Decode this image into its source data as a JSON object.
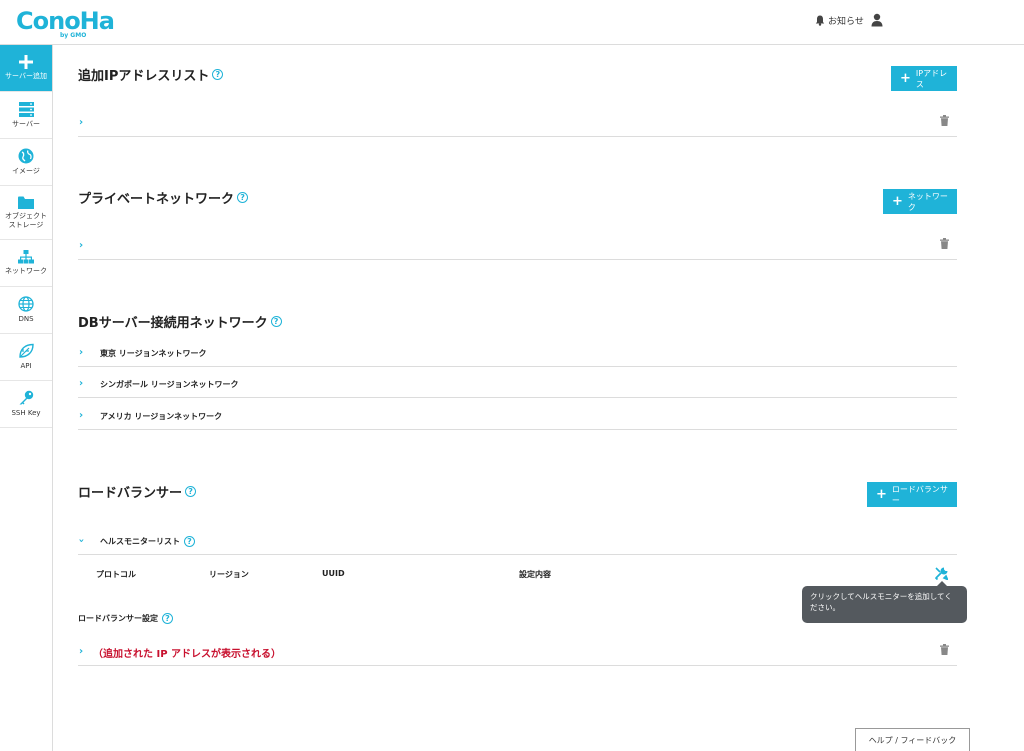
{
  "header": {
    "logo_text": "ConoHa",
    "logo_sub": "by GMO",
    "notice_label": "お知らせ"
  },
  "sidebar": {
    "items": [
      {
        "label": "サーバー追加",
        "icon": "plus-icon"
      },
      {
        "label": "サーバー",
        "icon": "server-icon"
      },
      {
        "label": "イメージ",
        "icon": "globe-icon"
      },
      {
        "label": "オブジェクト\nストレージ",
        "icon": "folder-icon"
      },
      {
        "label": "ネットワーク",
        "icon": "network-icon"
      },
      {
        "label": "DNS",
        "icon": "dns-globe-icon"
      },
      {
        "label": "API",
        "icon": "api-leaf-icon"
      },
      {
        "label": "SSH Key",
        "icon": "key-icon"
      }
    ]
  },
  "sections": {
    "ip_list": {
      "title": "追加IPアドレスリスト",
      "button": "IPアドレス"
    },
    "private_net": {
      "title": "プライベートネットワーク",
      "button": "ネットワーク"
    },
    "db_net": {
      "title": "DBサーバー接続用ネットワーク",
      "rows": [
        "東京 リージョンネットワーク",
        "シンガポール リージョンネットワーク",
        "アメリカ リージョンネットワーク"
      ]
    },
    "lb": {
      "title": "ロードバランサー",
      "button": "ロードバランサー",
      "health_list": "ヘルスモニターリスト",
      "columns": [
        "プロトコル",
        "リージョン",
        "UUID",
        "設定内容"
      ],
      "settings_label": "ロードバランサー設定",
      "added_ip_note": "（追加された IP アドレスが表示される）"
    }
  },
  "tooltip": "クリックしてヘルスモニターを追加してください。",
  "feedback": "ヘルプ / フィードバック",
  "colors": {
    "accent": "#1fb3d8",
    "red": "#c8102e",
    "tooltip_bg": "#54595e"
  }
}
